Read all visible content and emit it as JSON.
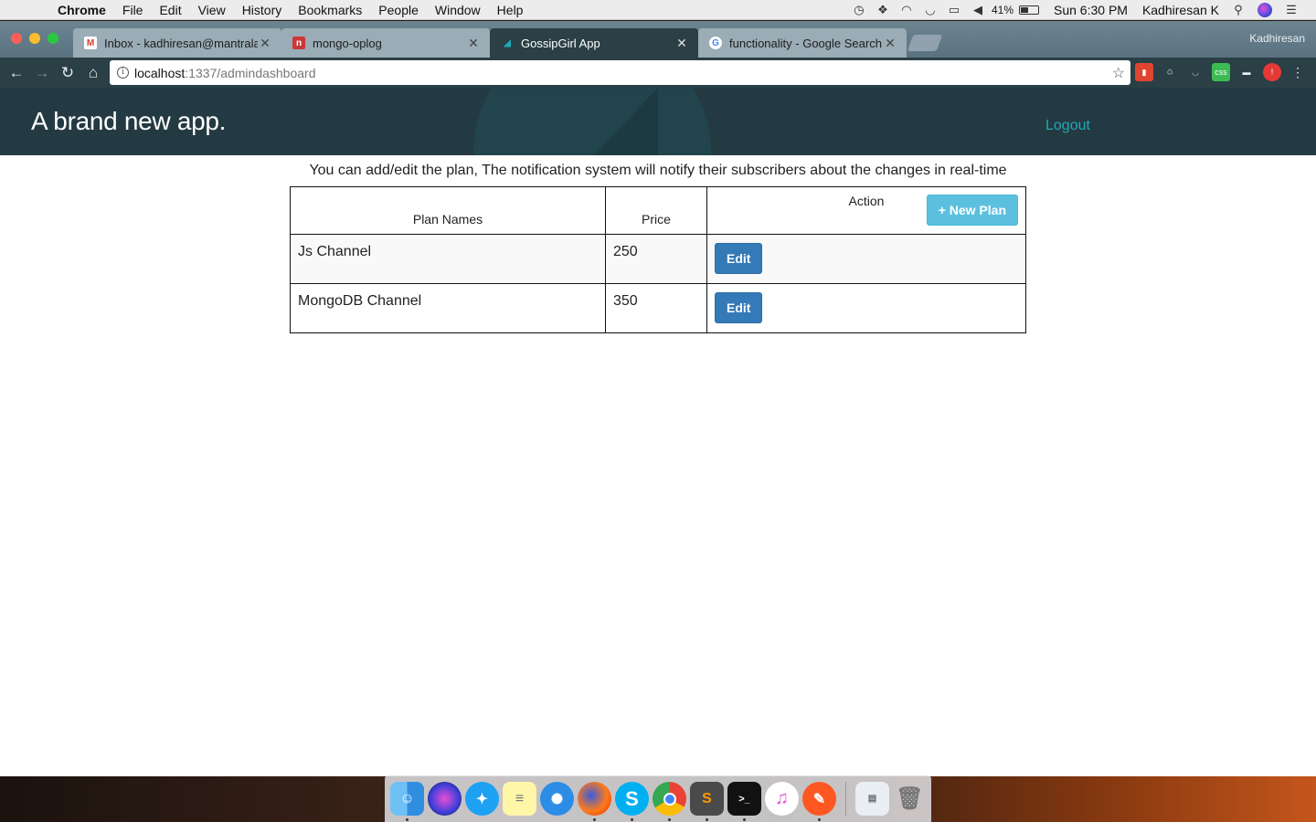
{
  "menubar": {
    "app_name": "Chrome",
    "menus": [
      "File",
      "Edit",
      "View",
      "History",
      "Bookmarks",
      "People",
      "Window",
      "Help"
    ],
    "battery": "41%",
    "clock": "Sun 6:30 PM",
    "user": "Kadhiresan K"
  },
  "browser": {
    "tabs": [
      {
        "title": "Inbox - kadhiresan@mantralab",
        "favicon": "gmail-icon",
        "active": false
      },
      {
        "title": "mongo-oplog",
        "favicon": "npm-icon",
        "active": false
      },
      {
        "title": "GossipGirl App",
        "favicon": "app-icon",
        "active": true
      },
      {
        "title": "functionality - Google Search",
        "favicon": "google-icon",
        "active": false
      }
    ],
    "profile_name": "Kadhiresan",
    "url_host": "localhost",
    "url_path": ":1337/admindashboard"
  },
  "app": {
    "brand": "A brand new app.",
    "logout_label": "Logout",
    "intro": "You can add/edit the plan, The notification system will notify their subscribers about the changes in real-time",
    "table": {
      "headers": {
        "name": "Plan Names",
        "price": "Price",
        "action": "Action"
      },
      "new_plan_label": "+ New Plan",
      "rows": [
        {
          "name": "Js Channel",
          "price": "250",
          "action_label": "Edit"
        },
        {
          "name": "MongoDB Channel",
          "price": "350",
          "action_label": "Edit"
        }
      ]
    }
  },
  "colors": {
    "header_bg": "#243a42",
    "logout_link": "#1fa9b8",
    "new_plan_button": "#5bc0de",
    "edit_button": "#337ab7"
  }
}
